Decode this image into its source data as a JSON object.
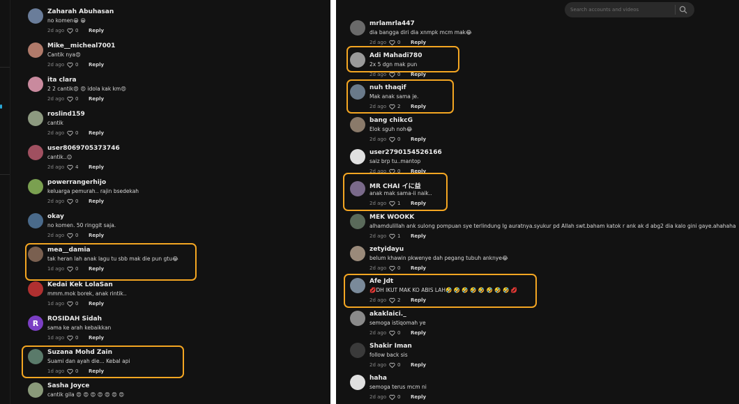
{
  "search": {
    "placeholder": "Search accounts and videos"
  },
  "labels": {
    "reply": "Reply"
  },
  "colors": {
    "highlight": "#f4a622",
    "background": "#121212",
    "rail_accent": "#2aa7d6"
  },
  "left_comments": [
    {
      "username": "Zaharah Abuhasan",
      "text": "no komen😀 😀",
      "date": "2d ago",
      "likes": "0",
      "avatar_color": "#6a7d9a"
    },
    {
      "username": "Mike__micheal7001",
      "text": "Cantik nya😍",
      "date": "2d ago",
      "likes": "0",
      "avatar_color": "#b07a6a"
    },
    {
      "username": "ita clara",
      "text": "2 2 cantik😍 😍 idola kak km😍",
      "date": "2d ago",
      "likes": "0",
      "avatar_color": "#c98a9e"
    },
    {
      "username": "roslind159",
      "text": "cantik",
      "date": "2d ago",
      "likes": "0",
      "avatar_color": "#8d9a80"
    },
    {
      "username": "user8069705373746",
      "text": "cantik..😊",
      "date": "2d ago",
      "likes": "4",
      "avatar_color": "#a05060"
    },
    {
      "username": "powerrangerhijo",
      "text": "keluarga pemurah.. rajin bsedekah",
      "date": "2d ago",
      "likes": "0",
      "avatar_color": "#7aa050"
    },
    {
      "username": "okay",
      "text": "no komen. 50 ringgit saja.",
      "date": "2d ago",
      "likes": "0",
      "avatar_color": "#4a6a8a"
    },
    {
      "username": "mea__damia",
      "text": "tak heran lah anak lagu tu sbb mak die pun gtu😂",
      "date": "1d ago",
      "likes": "0",
      "avatar_color": "#7a6050"
    },
    {
      "username": "Kedai Kek LolaSan",
      "text": "mmm.mok borek, anak rintik..",
      "date": "1d ago",
      "likes": "0",
      "avatar_color": "#b03030"
    },
    {
      "username": "ROSIDAH Sidah",
      "text": "sama ke arah kebaikkan",
      "date": "1d ago",
      "likes": "0",
      "avatar_color": "#7b3fc4",
      "avatar_letter": "R"
    },
    {
      "username": "Suzana Mohd Zain",
      "text": "Suami dan ayah die... Kebal api",
      "date": "1d ago",
      "likes": "0",
      "avatar_color": "#5a7a6a"
    },
    {
      "username": "Sasha Joyce",
      "text": "cantik gila 😍 😍 😍 😍 😍 😍 😍",
      "date": "",
      "likes": "",
      "avatar_color": "#8a9a7a"
    }
  ],
  "right_comments": [
    {
      "username": "mrlamrla447",
      "text": "dia bangga diri dia xnmpk mcm mak😂",
      "date": "2d ago",
      "likes": "0",
      "avatar_color": "#6a6a6a"
    },
    {
      "username": "Adi Mahadi780",
      "text": "2x 5 dgn mak pun",
      "date": "2d ago",
      "likes": "0",
      "avatar_color": "#9a9a9a"
    },
    {
      "username": "nuh thaqif",
      "text": "Mak anak sama je.",
      "date": "2d ago",
      "likes": "2",
      "avatar_color": "#6a7a8a"
    },
    {
      "username": "bang chikcG",
      "text": "Elok sguh noh😂",
      "date": "2d ago",
      "likes": "0",
      "avatar_color": "#8a7a6a"
    },
    {
      "username": "user2790154526166",
      "text": "saiz brp tu..mantop",
      "date": "2d ago",
      "likes": "0",
      "avatar_color": "#e0e0e0"
    },
    {
      "username": "MR CHAI イに益",
      "text": "anak mak sama-ii naik..",
      "date": "2d ago",
      "likes": "1",
      "avatar_color": "#7a6a8a"
    },
    {
      "username": "MEK WOOKK",
      "text": "alhamdulillah ank sulong pompuan sye terlindung lg auratnya.syukur pd Allah swt.baham katok r ank ak d abg2 dia kalo gini gaye.ahahaha",
      "date": "2d ago",
      "likes": "1",
      "avatar_color": "#5a6a5a"
    },
    {
      "username": "zetyidayu",
      "text": "belum khawin pkwenye dah pegang tubuh anknye😂",
      "date": "2d ago",
      "likes": "0",
      "avatar_color": "#9a8a7a"
    },
    {
      "username": "Afe Jdt",
      "text": "💋DH IKUT MAK KO ABIS LAH🤣 🤣 🤣 🤣 🤣 🤣 🤣 🤣 💋",
      "date": "2d ago",
      "likes": "2",
      "avatar_color": "#7a8a9a"
    },
    {
      "username": "akaklaici._",
      "text": "semoga istiqomah ye",
      "date": "2d ago",
      "likes": "0",
      "avatar_color": "#8a8a8a"
    },
    {
      "username": "Shakir Iman",
      "text": "follow back sis",
      "date": "2d ago",
      "likes": "0",
      "avatar_color": "#3a3a3a"
    },
    {
      "username": "haha",
      "text": "semoga terus mcm ni",
      "date": "2d ago",
      "likes": "0",
      "avatar_color": "#e0e0e0"
    }
  ]
}
